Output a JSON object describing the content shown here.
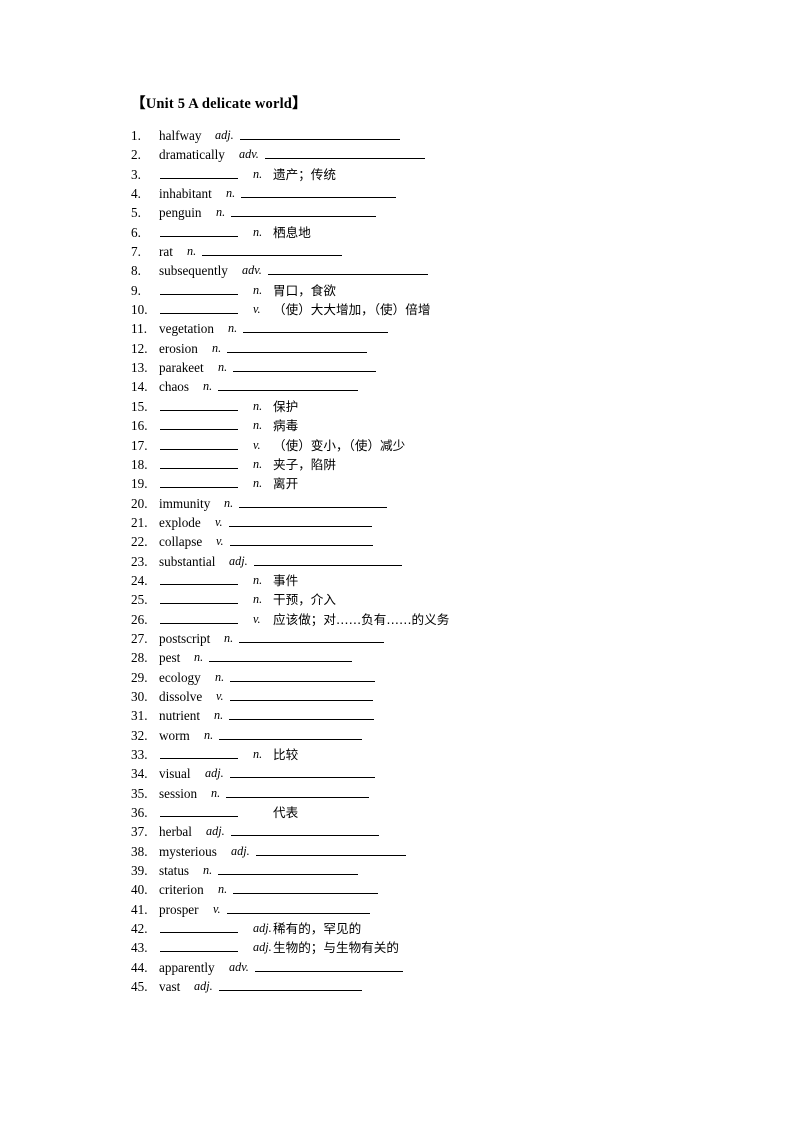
{
  "document": {
    "title": "【Unit 5 A delicate world】"
  },
  "rows": [
    {
      "num": "1.",
      "word": "halfway",
      "pos": "adj.",
      "def": "",
      "blank_len": 160
    },
    {
      "num": "2.",
      "word": "dramatically",
      "pos": "adv.",
      "def": "",
      "blank_len": 160
    },
    {
      "num": "3.",
      "word": "",
      "pos": "n.",
      "def": "遗产；传统",
      "blank_len": 0
    },
    {
      "num": "4.",
      "word": "inhabitant",
      "pos": "n.",
      "def": "",
      "blank_len": 155
    },
    {
      "num": "5.",
      "word": "penguin",
      "pos": "n.",
      "def": "",
      "blank_len": 145
    },
    {
      "num": "6.",
      "word": "",
      "pos": "n.",
      "def": "栖息地",
      "blank_len": 0
    },
    {
      "num": "7.",
      "word": "rat",
      "pos": "n.",
      "def": "",
      "blank_len": 140
    },
    {
      "num": "8.",
      "word": "subsequently",
      "pos": "adv.",
      "def": "",
      "blank_len": 160
    },
    {
      "num": "9.",
      "word": "",
      "pos": "n.",
      "def": "胃口，食欲",
      "blank_len": 0
    },
    {
      "num": "10.",
      "word": "",
      "pos": "v.",
      "def": "（使）大大增加，（使）倍增",
      "blank_len": 0
    },
    {
      "num": "11.",
      "word": "vegetation",
      "pos": "n.",
      "def": "",
      "blank_len": 145
    },
    {
      "num": "12.",
      "word": "erosion",
      "pos": "n.",
      "def": "",
      "blank_len": 140
    },
    {
      "num": "13.",
      "word": "parakeet",
      "pos": "n.",
      "def": "",
      "blank_len": 143
    },
    {
      "num": "14.",
      "word": "chaos",
      "pos": "n.",
      "def": "",
      "blank_len": 140
    },
    {
      "num": "15.",
      "word": "",
      "pos": "n.",
      "def": "保护",
      "blank_len": 0
    },
    {
      "num": "16.",
      "word": "",
      "pos": "n.",
      "def": "病毒",
      "blank_len": 0
    },
    {
      "num": "17.",
      "word": "",
      "pos": "v.",
      "def": "（使）变小，（使）减少",
      "blank_len": 0
    },
    {
      "num": "18.",
      "word": "",
      "pos": "n.",
      "def": "夹子，陷阱",
      "blank_len": 0
    },
    {
      "num": "19.",
      "word": "",
      "pos": "n.",
      "def": "离开",
      "blank_len": 0
    },
    {
      "num": "20.",
      "word": "immunity",
      "pos": "n.",
      "def": "",
      "blank_len": 148
    },
    {
      "num": "21.",
      "word": "explode",
      "pos": "v.",
      "def": "",
      "blank_len": 143
    },
    {
      "num": "22.",
      "word": "collapse",
      "pos": "v.",
      "def": "",
      "blank_len": 143
    },
    {
      "num": "23.",
      "word": "substantial",
      "pos": "adj.",
      "def": "",
      "blank_len": 148
    },
    {
      "num": "24.",
      "word": "",
      "pos": "n.",
      "def": "事件",
      "blank_len": 0
    },
    {
      "num": "25.",
      "word": "",
      "pos": "n.",
      "def": "干预，介入",
      "blank_len": 0
    },
    {
      "num": "26.",
      "word": "",
      "pos": "v.",
      "def": "应该做；对……负有……的义务",
      "blank_len": 0
    },
    {
      "num": "27.",
      "word": "postscript",
      "pos": "n.",
      "def": "",
      "blank_len": 145
    },
    {
      "num": "28.",
      "word": "pest",
      "pos": "n.",
      "def": "",
      "blank_len": 143
    },
    {
      "num": "29.",
      "word": "ecology",
      "pos": "n.",
      "def": "",
      "blank_len": 145
    },
    {
      "num": "30.",
      "word": "dissolve",
      "pos": "v.",
      "def": "",
      "blank_len": 143
    },
    {
      "num": "31.",
      "word": "nutrient",
      "pos": "n.",
      "def": "",
      "blank_len": 145
    },
    {
      "num": "32.",
      "word": "worm",
      "pos": "n.",
      "def": "",
      "blank_len": 143
    },
    {
      "num": "33.",
      "word": "",
      "pos": "n.",
      "def": "比较",
      "blank_len": 0
    },
    {
      "num": "34.",
      "word": "visual",
      "pos": "adj.",
      "def": "",
      "blank_len": 145
    },
    {
      "num": "35.",
      "word": "session",
      "pos": "n.",
      "def": "",
      "blank_len": 143
    },
    {
      "num": "36.",
      "word": "",
      "pos": "",
      "def": "代表",
      "blank_len": 0
    },
    {
      "num": "37.",
      "word": "herbal",
      "pos": "adj.",
      "def": "",
      "blank_len": 148
    },
    {
      "num": "38.",
      "word": "mysterious",
      "pos": "adj.",
      "def": "",
      "blank_len": 150
    },
    {
      "num": "39.",
      "word": "status",
      "pos": "n.",
      "def": "",
      "blank_len": 140
    },
    {
      "num": "40.",
      "word": "criterion",
      "pos": "n.",
      "def": "",
      "blank_len": 145
    },
    {
      "num": "41.",
      "word": "prosper",
      "pos": "v.",
      "def": "",
      "blank_len": 143
    },
    {
      "num": "42.",
      "word": "",
      "pos": "adj.",
      "def": "稀有的，罕见的",
      "blank_len": 0
    },
    {
      "num": "43.",
      "word": "",
      "pos": "adj.",
      "def": "生物的；与生物有关的",
      "blank_len": 0
    },
    {
      "num": "44.",
      "word": "apparently",
      "pos": "adv.",
      "def": "",
      "blank_len": 148
    },
    {
      "num": "45.",
      "word": "vast",
      "pos": "adj.",
      "def": "",
      "blank_len": 143
    }
  ]
}
